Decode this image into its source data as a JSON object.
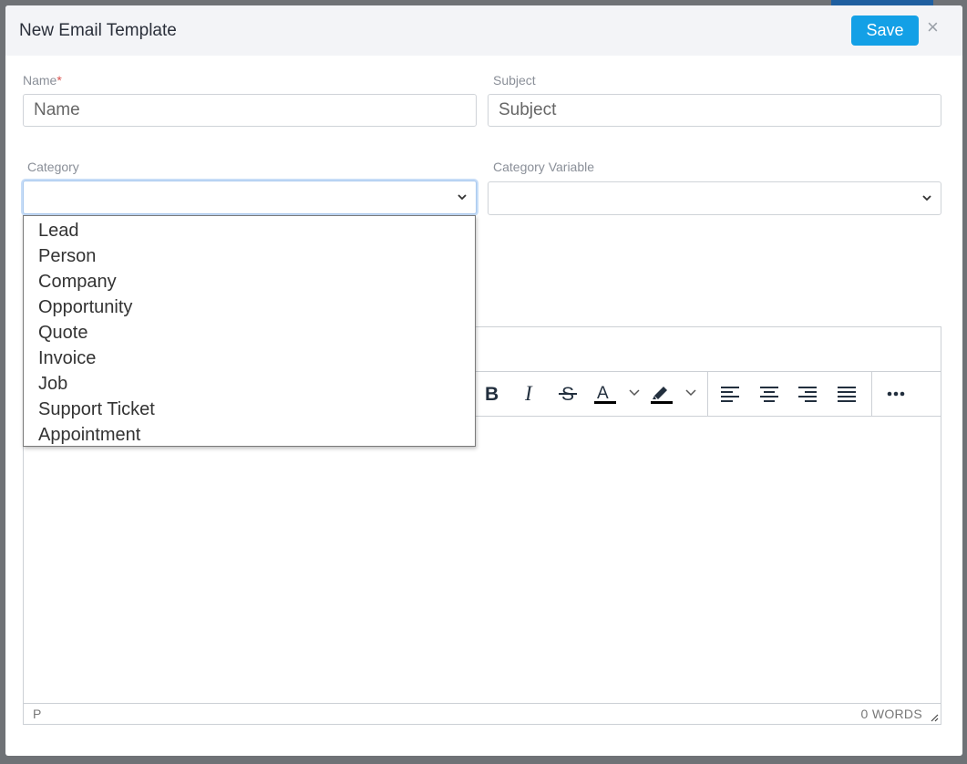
{
  "dialog": {
    "title": "New Email Template",
    "save_label": "Save",
    "close_glyph": "×"
  },
  "form": {
    "name_label": "Name",
    "name_required_marker": "*",
    "name_placeholder": "Name",
    "subject_label": "Subject",
    "subject_placeholder": "Subject",
    "category_label": "Category",
    "category_value": "",
    "category_variable_label": "Category Variable",
    "category_variable_value": ""
  },
  "category_dropdown": {
    "open": true,
    "options": [
      "Lead",
      "Person",
      "Company",
      "Opportunity",
      "Quote",
      "Invoice",
      "Job",
      "Support Ticket",
      "Appointment"
    ]
  },
  "editor": {
    "toolbar": [
      {
        "name": "bold-button",
        "icon": "bold-icon"
      },
      {
        "name": "italic-button",
        "icon": "italic-icon"
      },
      {
        "name": "strikethrough-button",
        "icon": "strikethrough-icon"
      },
      {
        "name": "text-color-button",
        "icon": "text-color-icon"
      },
      {
        "name": "highlight-color-button",
        "icon": "highlighter-icon"
      },
      {
        "name": "align-left-button",
        "icon": "align-left-icon"
      },
      {
        "name": "align-center-button",
        "icon": "align-center-icon"
      },
      {
        "name": "align-right-button",
        "icon": "align-right-icon"
      },
      {
        "name": "align-justify-button",
        "icon": "align-justify-icon"
      },
      {
        "name": "more-button",
        "icon": "more-icon"
      }
    ],
    "status_path": "P",
    "word_count": "0 WORDS"
  },
  "colors": {
    "accent": "#13a0e6",
    "required": "#d9534f",
    "header_bg": "#f3f4f7",
    "focus_ring": "#c7ddf7"
  }
}
